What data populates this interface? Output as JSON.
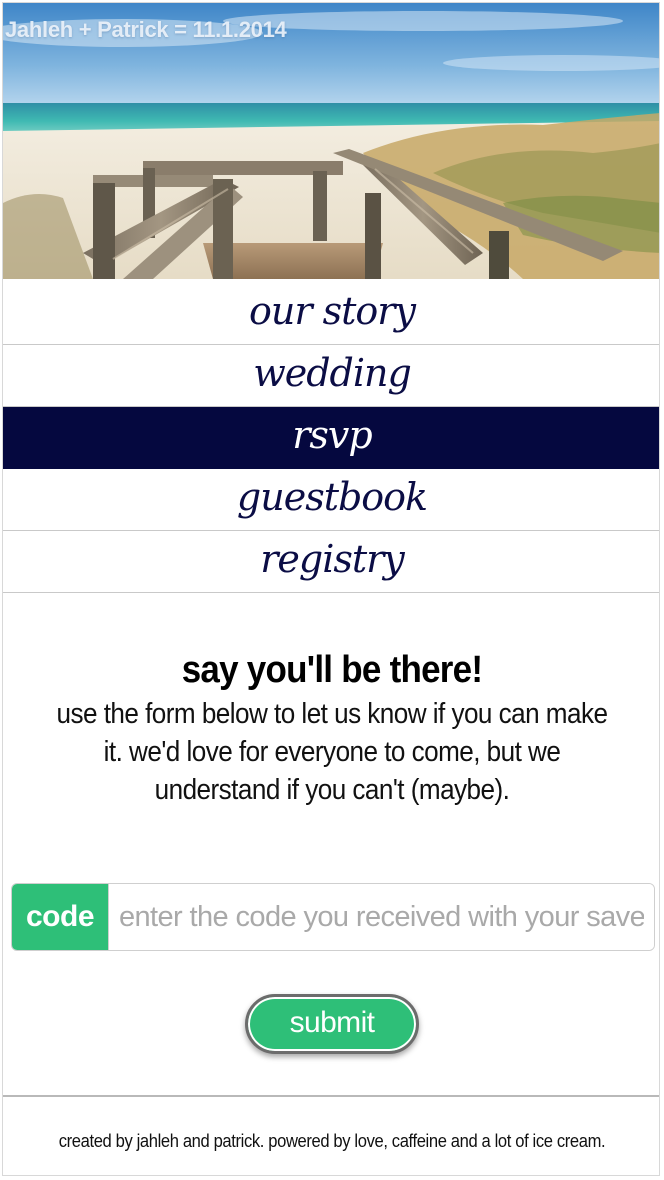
{
  "header": {
    "title": "Jahleh + Patrick = 11.1.2014"
  },
  "nav": {
    "items": [
      {
        "label": "our story",
        "active": false
      },
      {
        "label": "wedding",
        "active": false
      },
      {
        "label": "rsvp",
        "active": true
      },
      {
        "label": "guestbook",
        "active": false
      },
      {
        "label": "registry",
        "active": false
      }
    ]
  },
  "content": {
    "heading": "say you'll be there!",
    "description": "use the form below to let us know if you can make it. we'd love for everyone to come, but we understand if you can't (maybe)."
  },
  "form": {
    "code_label": "code",
    "code_placeholder": "enter the code you received with your save the date",
    "code_value": "",
    "submit_label": "submit"
  },
  "footer": {
    "text": "created by jahleh and patrick. powered by love, caffeine and a lot of ice cream."
  },
  "colors": {
    "navy": "#05083f",
    "accent_green": "#2ebf78",
    "nav_text": "#0b0d45"
  }
}
